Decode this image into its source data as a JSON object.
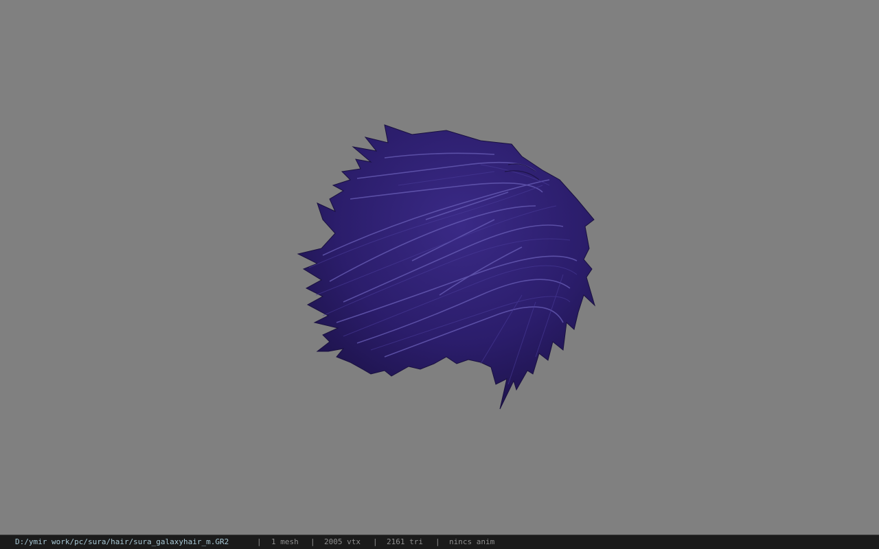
{
  "viewport": {
    "background_color": "#808080",
    "model": {
      "icon": "hair-mesh-icon",
      "base_color": "#2b1d6b",
      "highlight_color": "#6a5fb8"
    }
  },
  "statusbar": {
    "file_path": "D:/ymir work/pc/sura/hair/sura_galaxyhair_m.GR2",
    "separator": "|",
    "mesh_count": "1 mesh",
    "vertex_count": "2005 vtx",
    "triangle_count": "2161 tri",
    "anim_status": "nincs anim",
    "path_color": "#a9c9d6",
    "text_color": "#8f8f8f"
  }
}
